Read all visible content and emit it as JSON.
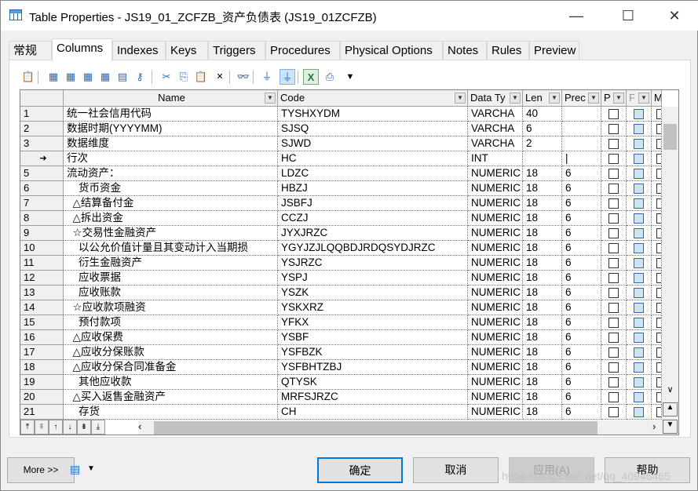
{
  "window": {
    "title": "Table Properties - JS19_01_ZCFZB_资产负债表 (JS19_01ZCFZB)",
    "min_icon": "minimize-icon",
    "max_icon": "maximize-icon",
    "close_icon": "close-icon"
  },
  "tabs": [
    {
      "label": "常规"
    },
    {
      "label": "Columns",
      "active": true
    },
    {
      "label": "Indexes"
    },
    {
      "label": "Keys"
    },
    {
      "label": "Triggers"
    },
    {
      "label": "Procedures"
    },
    {
      "label": "Physical Options"
    },
    {
      "label": "Notes"
    },
    {
      "label": "Rules"
    },
    {
      "label": "Preview"
    }
  ],
  "toolbar": [
    "properties-icon",
    "insert-row-icon",
    "add-row-icon",
    "add-columns-icon",
    "reuse-columns-icon",
    "new-sequence-icon",
    "key-icon",
    "cut-icon",
    "copy-icon",
    "paste-icon",
    "delete-icon",
    "find-icon",
    "filter-icon",
    "filter-active-icon",
    "excel-export-icon",
    "print-icon",
    "dropdown-icon"
  ],
  "grid": {
    "headers": {
      "name": "Name",
      "code": "Code",
      "datatype": "Data Ty",
      "len": "Len",
      "prec": "Prec",
      "p": "P",
      "f": "F",
      "m": "M"
    },
    "rows": [
      {
        "num": "1",
        "name": "统一社会信用代码",
        "code": "TYSHXYDM",
        "type": "VARCHA",
        "len": "40",
        "prec": ""
      },
      {
        "num": "2",
        "name": "数据时期(YYYYMM)",
        "code": "SJSQ",
        "type": "VARCHA",
        "len": "6",
        "prec": ""
      },
      {
        "num": "3",
        "name": "数据维度",
        "code": "SJWD",
        "type": "VARCHA",
        "len": "2",
        "prec": ""
      },
      {
        "num": "➜",
        "name": "行次",
        "code": "HC",
        "type": "INT",
        "len": "",
        "prec": "|"
      },
      {
        "num": "5",
        "name": "流动资产：",
        "code": "LDZC",
        "type": "NUMERIC",
        "len": "18",
        "prec": "6"
      },
      {
        "num": "6",
        "name": "    货币资金",
        "code": "HBZJ",
        "type": "NUMERIC",
        "len": "18",
        "prec": "6"
      },
      {
        "num": "7",
        "name": "  △结算备付金",
        "code": "JSBFJ",
        "type": "NUMERIC",
        "len": "18",
        "prec": "6"
      },
      {
        "num": "8",
        "name": "  △拆出资金",
        "code": "CCZJ",
        "type": "NUMERIC",
        "len": "18",
        "prec": "6"
      },
      {
        "num": "9",
        "name": "  ☆交易性金融资产",
        "code": "JYXJRZC",
        "type": "NUMERIC",
        "len": "18",
        "prec": "6"
      },
      {
        "num": "10",
        "name": "    以公允价值计量且其变动计入当期损",
        "code": "YGYJZJLQQBDJRDQSYDJRZC",
        "type": "NUMERIC",
        "len": "18",
        "prec": "6"
      },
      {
        "num": "11",
        "name": "    衍生金融资产",
        "code": "YSJRZC",
        "type": "NUMERIC",
        "len": "18",
        "prec": "6"
      },
      {
        "num": "12",
        "name": "    应收票据",
        "code": "YSPJ",
        "type": "NUMERIC",
        "len": "18",
        "prec": "6"
      },
      {
        "num": "13",
        "name": "    应收账款",
        "code": "YSZK",
        "type": "NUMERIC",
        "len": "18",
        "prec": "6"
      },
      {
        "num": "14",
        "name": "  ☆应收款项融资",
        "code": "YSKXRZ",
        "type": "NUMERIC",
        "len": "18",
        "prec": "6"
      },
      {
        "num": "15",
        "name": "    预付款项",
        "code": "YFKX",
        "type": "NUMERIC",
        "len": "18",
        "prec": "6"
      },
      {
        "num": "16",
        "name": "  △应收保费",
        "code": "YSBF",
        "type": "NUMERIC",
        "len": "18",
        "prec": "6"
      },
      {
        "num": "17",
        "name": "  △应收分保账款",
        "code": "YSFBZK",
        "type": "NUMERIC",
        "len": "18",
        "prec": "6"
      },
      {
        "num": "18",
        "name": "  △应收分保合同准备金",
        "code": "YSFBHTZBJ",
        "type": "NUMERIC",
        "len": "18",
        "prec": "6"
      },
      {
        "num": "19",
        "name": "    其他应收款",
        "code": "QTYSK",
        "type": "NUMERIC",
        "len": "18",
        "prec": "6"
      },
      {
        "num": "20",
        "name": "  △买入返售金融资产",
        "code": "MRFSJRZC",
        "type": "NUMERIC",
        "len": "18",
        "prec": "6"
      },
      {
        "num": "21",
        "name": "    存货",
        "code": "CH",
        "type": "NUMERIC",
        "len": "18",
        "prec": "6"
      }
    ]
  },
  "footer": {
    "more": "More >>",
    "ok": "确定",
    "cancel": "取消",
    "apply": "应用(A)",
    "help": "帮助",
    "watermark": "https://blog.csdn.net/qq_40946465"
  },
  "colors": {
    "focus": "#0078d7",
    "f_checkbox": "#cde4f7"
  }
}
